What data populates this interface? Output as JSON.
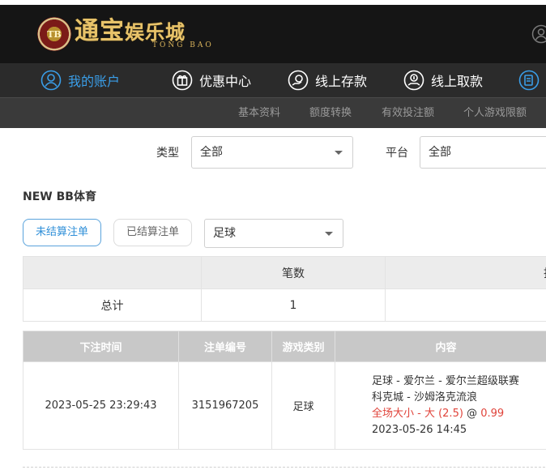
{
  "header": {
    "logo_badge": "TB",
    "logo_main": "通宝",
    "logo_small": "娱乐城",
    "logo_sub": "TONG BAO"
  },
  "main_nav": [
    {
      "label": "我的账户",
      "icon": "user-circle-icon",
      "active": true
    },
    {
      "label": "优惠中心",
      "icon": "gift-icon",
      "active": false
    },
    {
      "label": "线上存款",
      "icon": "deposit-icon",
      "active": false
    },
    {
      "label": "线上取款",
      "icon": "withdraw-icon",
      "active": false
    }
  ],
  "sub_nav": [
    "基本资料",
    "额度转换",
    "有效投注额",
    "个人游戏限额"
  ],
  "filters": {
    "type_label": "类型",
    "type_value": "全部",
    "platform_label": "平台",
    "platform_value": "全部"
  },
  "section_title": "NEW BB体育",
  "tabs": {
    "unsettled": "未结算注单",
    "settled": "已结算注单",
    "sport_value": "足球"
  },
  "summary": {
    "header_count": "笔数",
    "header_partial": "投",
    "row_label": "总计",
    "count": "1"
  },
  "detail": {
    "headers": [
      "下注时间",
      "注单编号",
      "游戏类别",
      "内容"
    ],
    "rows": [
      {
        "time": "2023-05-25 23:29:43",
        "order_no": "3151967205",
        "game_type": "足球",
        "line1": "足球 - 爱尔兰 - 爱尔兰超级联赛",
        "line2": "科克城 - 沙姆洛克流浪",
        "bet": "全场大小 - 大 (2.5)",
        "at": "@",
        "odds": "0.99",
        "match_time": "2023-05-26 14:45"
      }
    ]
  },
  "colors": {
    "accent": "#3a9ee8",
    "header_bg": "#151515",
    "nav_bg": "#2b2b2b",
    "subnav_bg": "#3a3a3a",
    "gold": "#e8c36a",
    "red": "#e0433a"
  }
}
